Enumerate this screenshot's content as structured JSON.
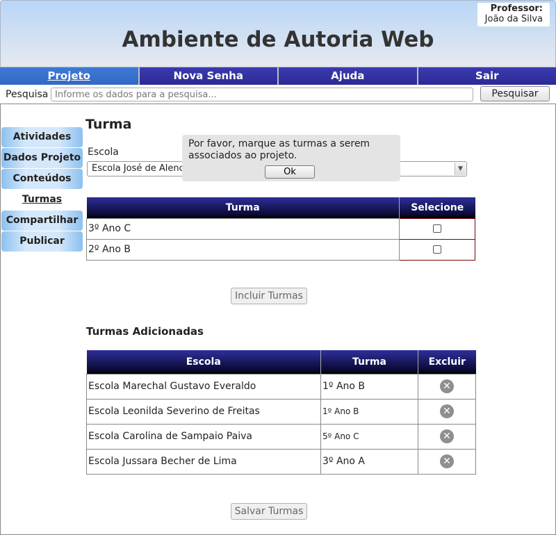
{
  "header": {
    "title": "Ambiente de Autoria Web",
    "professor_label": "Professor:",
    "professor_name": "João da Silva"
  },
  "nav": {
    "items": [
      {
        "label": "Projeto"
      },
      {
        "label": "Nova Senha"
      },
      {
        "label": "Ajuda"
      },
      {
        "label": "Sair"
      }
    ],
    "active": "Projeto"
  },
  "search": {
    "label": "Pesquisa",
    "placeholder": "Informe os dados para a pesquisa...",
    "value": "",
    "button_label": "Pesquisar"
  },
  "sidebar": {
    "items": [
      {
        "label": "Atividades"
      },
      {
        "label": "Dados Projeto"
      },
      {
        "label": "Conteúdos"
      },
      {
        "label": "Turmas"
      },
      {
        "label": "Compartilhar"
      },
      {
        "label": "Publicar"
      }
    ],
    "active": "Turmas"
  },
  "main": {
    "title": "Turma",
    "escola_label": "Escola",
    "escola_selected": "Escola José de Alencar",
    "popup": {
      "message": "Por favor, marque as turmas a serem associados ao projeto.",
      "ok_label": "Ok"
    },
    "turma_table": {
      "headers": [
        "Turma",
        "Selecione"
      ],
      "rows": [
        {
          "turma": "3º Ano C",
          "checked": false
        },
        {
          "turma": "2º Ano B",
          "checked": false
        }
      ]
    },
    "incluir_label": "Incluir Turmas",
    "added_title": "Turmas Adicionadas",
    "added_table": {
      "headers": [
        "Escola",
        "Turma",
        "Excluir"
      ],
      "rows": [
        {
          "escola": "Escola Marechal Gustavo Everaldo",
          "turma": "1º Ano B"
        },
        {
          "escola": "Escola Leonilda Severino de Freitas",
          "turma": "1º Ano B"
        },
        {
          "escola": "Escola Carolina de Sampaio Paiva",
          "turma": "5º Ano C"
        },
        {
          "escola": "Escola Jussara Becher de Lima",
          "turma": "3º Ano A"
        }
      ]
    },
    "salvar_label": "Salvar Turmas"
  },
  "colors": {
    "nav_bg": "#2a2a95",
    "nav_active": "#3368c4",
    "table_header": "#0b0b3a",
    "sidebar_bg": "#d5e8fb"
  },
  "icons": {
    "delete": "close-circle-icon",
    "select_arrow": "chevron-down-icon"
  }
}
